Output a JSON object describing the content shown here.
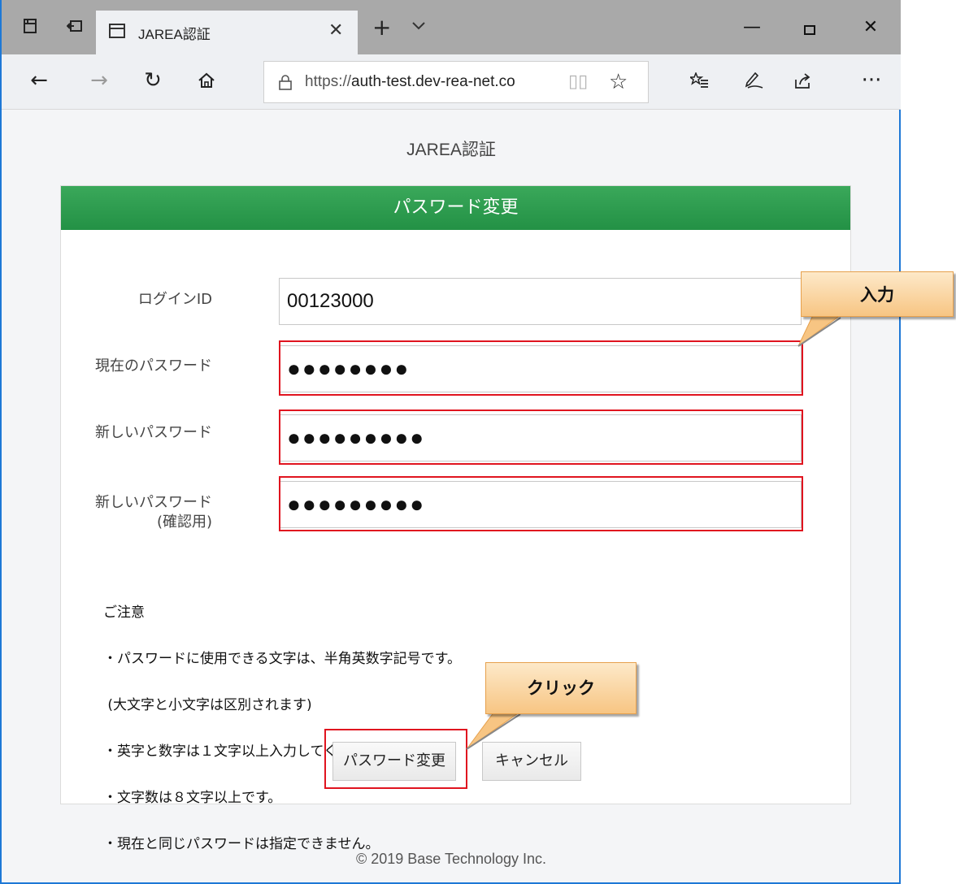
{
  "browser": {
    "tab_title": "JAREA認証",
    "url_scheme": "https://",
    "url_host": "auth-test.dev-rea-net.co",
    "icons": {
      "tab_actions": "tab-actions-icon",
      "set_aside": "set-aside-tabs-icon",
      "back": "back-arrow-icon",
      "forward": "forward-arrow-icon",
      "refresh": "refresh-icon",
      "home": "home-icon",
      "lock": "lock-icon",
      "reading_view": "reading-view-icon",
      "favorite": "star-icon",
      "favorites_list": "favorites-list-icon",
      "notes": "pen-icon",
      "share": "share-icon",
      "more": "more-icon"
    }
  },
  "page": {
    "site_title": "JAREA認証",
    "card_title": "パスワード変更",
    "fields": {
      "login_id": {
        "label": "ログインID",
        "value": "00123000"
      },
      "current_password": {
        "label": "現在のパスワード",
        "value": "●●●●●●●●"
      },
      "new_password": {
        "label": "新しいパスワード",
        "value": "●●●●●●●●●"
      },
      "confirm_password": {
        "label_line1": "新しいパスワード",
        "label_line2": "(確認用)",
        "value": "●●●●●●●●●"
      }
    },
    "notice": {
      "heading": "ご注意",
      "lines": [
        "・パスワードに使用できる文字は、半角英数字記号です。",
        " (大文字と小文字は区別されます)",
        "・英字と数字は１文字以上入力してください。",
        "・文字数は８文字以上です。",
        "・現在と同じパスワードは指定できません。"
      ]
    },
    "buttons": {
      "submit": "パスワード変更",
      "cancel": "キャンセル"
    },
    "footer": "© 2019 Base Technology Inc."
  },
  "annotations": {
    "input_callout": "入力",
    "click_callout": "クリック",
    "highlight_color": "#e0141f",
    "callout_color": "#f7c583"
  }
}
